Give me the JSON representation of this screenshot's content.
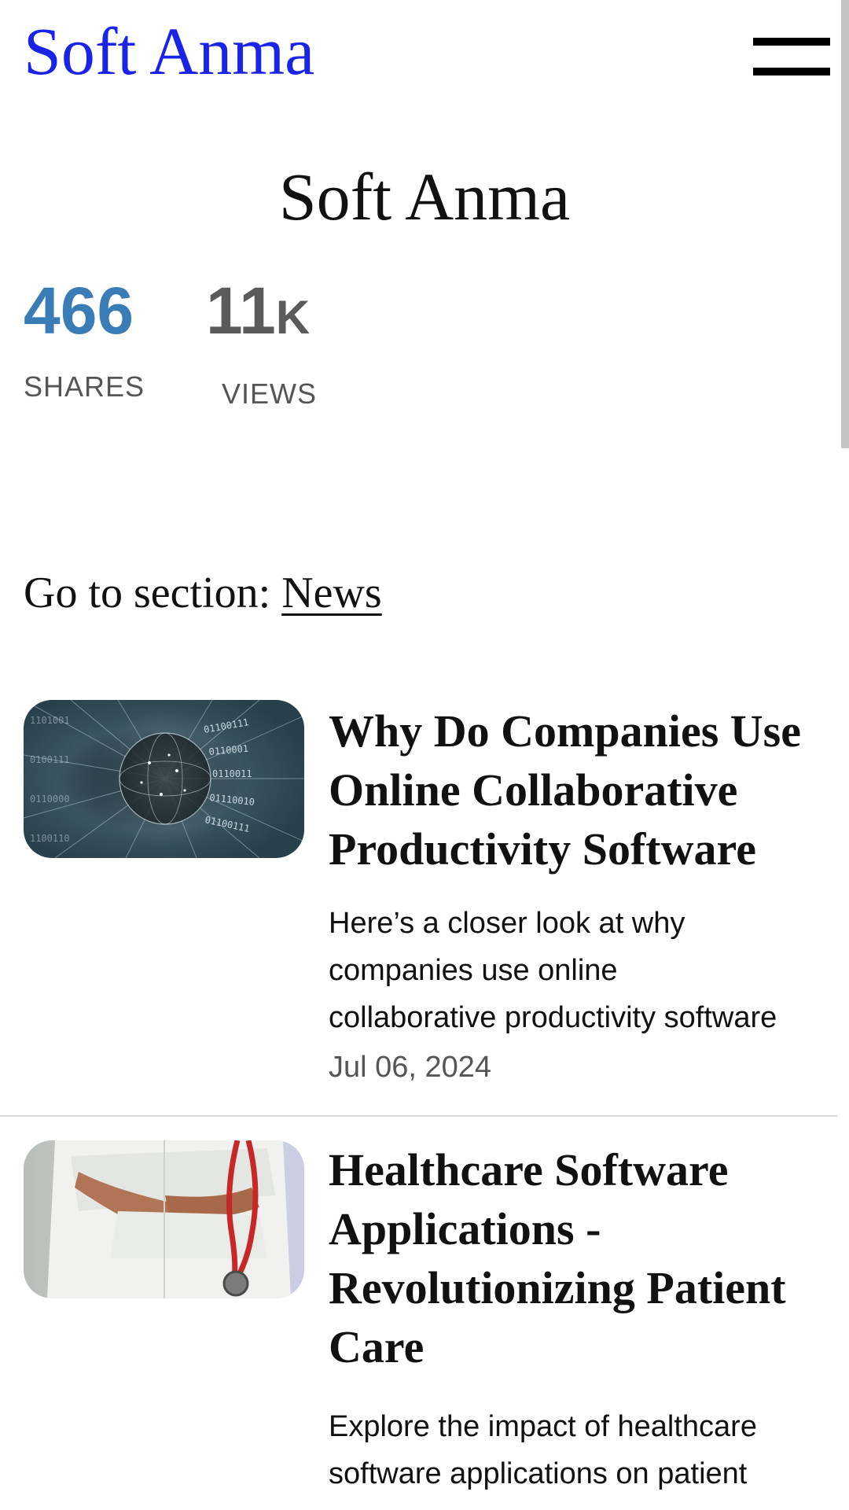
{
  "header": {
    "logo_text": "Soft Anma",
    "menu_icon": "hamburger-menu-icon"
  },
  "hero": {
    "title": "Soft Anma"
  },
  "stats": {
    "shares_value": "466",
    "shares_label": "SHARES",
    "views_value": "11",
    "views_suffix": "K",
    "views_label": "VIEWS"
  },
  "section_nav": {
    "prefix": "Go to section:",
    "link": "News"
  },
  "articles": [
    {
      "title": "Why Do Companies Use Online Collaborative Productivity Software",
      "excerpt_line1": "Here’s a closer look at why",
      "excerpt_line2": "companies use online",
      "excerpt_line3": "collaborative productivity software",
      "date": "Jul 06, 2024",
      "image": "binary-data-globe-image"
    },
    {
      "title": "Healthcare Software Applications - Revolutionizing Patient Care",
      "excerpt": "Explore the impact of healthcare software applications on patient",
      "image": "doctor-with-stethoscope-image"
    }
  ],
  "colors": {
    "logo": "#1a24e6",
    "shares": "#3a7cb6",
    "views": "#5b5b5b"
  }
}
